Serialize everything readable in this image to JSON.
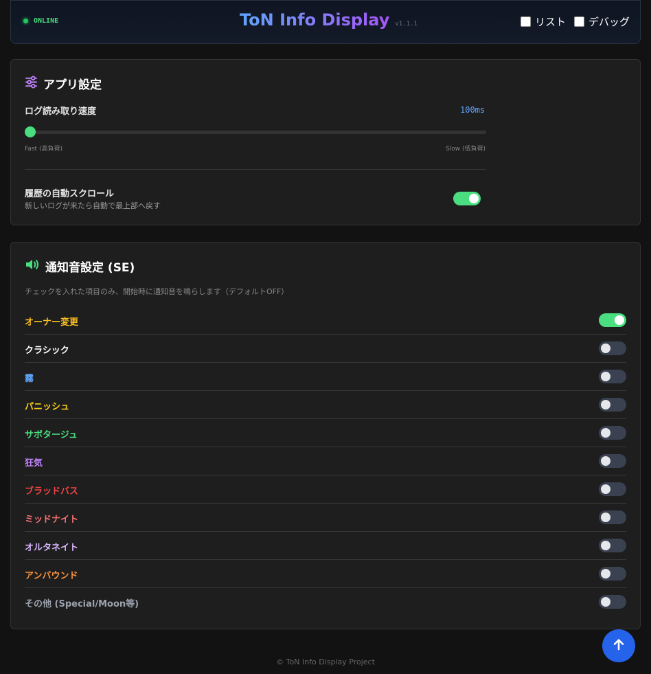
{
  "header": {
    "status": "ONLINE",
    "title": "ToN Info Display",
    "version": "v1.1.1",
    "list_label": "リスト",
    "debug_label": "デバッグ"
  },
  "app_settings": {
    "title": "アプリ設定",
    "log_speed_label": "ログ読み取り速度",
    "log_speed_value": "100ms",
    "slider_fraction": 0.0,
    "slider_min_label": "Fast (高負荷)",
    "slider_max_label": "Slow (低負荷)",
    "auto_scroll_label": "履歴の自動スクロール",
    "auto_scroll_desc": "新しいログが来たら自動で最上部へ戻す",
    "auto_scroll_on": true
  },
  "se_settings": {
    "title": "通知音設定 (SE)",
    "description": "チェックを入れた項目のみ、開始時に通知音を鳴らします（デフォルトOFF）",
    "items": [
      {
        "label": "オーナー変更",
        "color": "#fbbf24",
        "on": true
      },
      {
        "label": "クラシック",
        "color": "#ffffff",
        "on": false
      },
      {
        "label": "霧",
        "color": "#60a5fa",
        "on": false
      },
      {
        "label": "パニッシュ",
        "color": "#facc15",
        "on": false
      },
      {
        "label": "サボタージュ",
        "color": "#4ade80",
        "on": false
      },
      {
        "label": "狂気",
        "color": "#c084fc",
        "on": false
      },
      {
        "label": "ブラッドバス",
        "color": "#ef4444",
        "on": false
      },
      {
        "label": "ミッドナイト",
        "color": "#f87171",
        "on": false
      },
      {
        "label": "オルタネイト",
        "color": "#d8b4fe",
        "on": false
      },
      {
        "label": "アンバウンド",
        "color": "#fb923c",
        "on": false
      },
      {
        "label": "その他 (Special/Moon等)",
        "color": "#9ca3af",
        "on": false
      }
    ]
  },
  "footer": "© ToN Info Display Project",
  "colors": {
    "accent_green": "#4ade80",
    "accent_blue": "#60a5fa",
    "fab_blue": "#2563eb"
  }
}
